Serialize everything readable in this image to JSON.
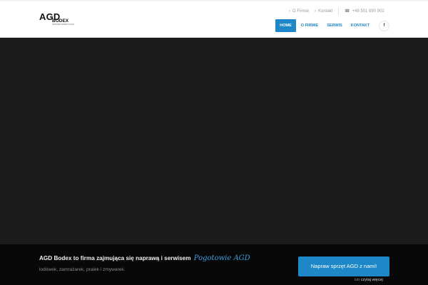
{
  "logo": {
    "main": "AGD",
    "sub": "BODEX",
    "tagline": "NAPRAWA SPRZĘTU AGD"
  },
  "top_links": [
    {
      "label": "O Firmie"
    },
    {
      "label": "Kontakt"
    }
  ],
  "phone": "+48 501 690 902",
  "nav": [
    {
      "label": "HOME",
      "active": true
    },
    {
      "label": "O FIRMIE",
      "active": false
    },
    {
      "label": "SERWIS",
      "active": false
    },
    {
      "label": "KONTAKT",
      "active": false
    }
  ],
  "social": {
    "facebook_label": "f"
  },
  "icons": {
    "chevron": "chevron-right-icon",
    "phone": "phone-icon",
    "facebook": "facebook-icon"
  },
  "banner": {
    "headline": "AGD Bodex to firma zajmująca się naprawą i serwisem",
    "headline_accent": "Pogotowie AGD",
    "subtext": "lodówek, zamrażarek, pralek i zmywarek.",
    "cta_label": "Napraw sprzęt AGD z nami!",
    "more_prefix": "lub",
    "more_link": "czytaj więcej"
  },
  "colors": {
    "accent": "#1d87c8",
    "hero_bg": "#1b1b1b",
    "footer_bg": "#080808"
  }
}
